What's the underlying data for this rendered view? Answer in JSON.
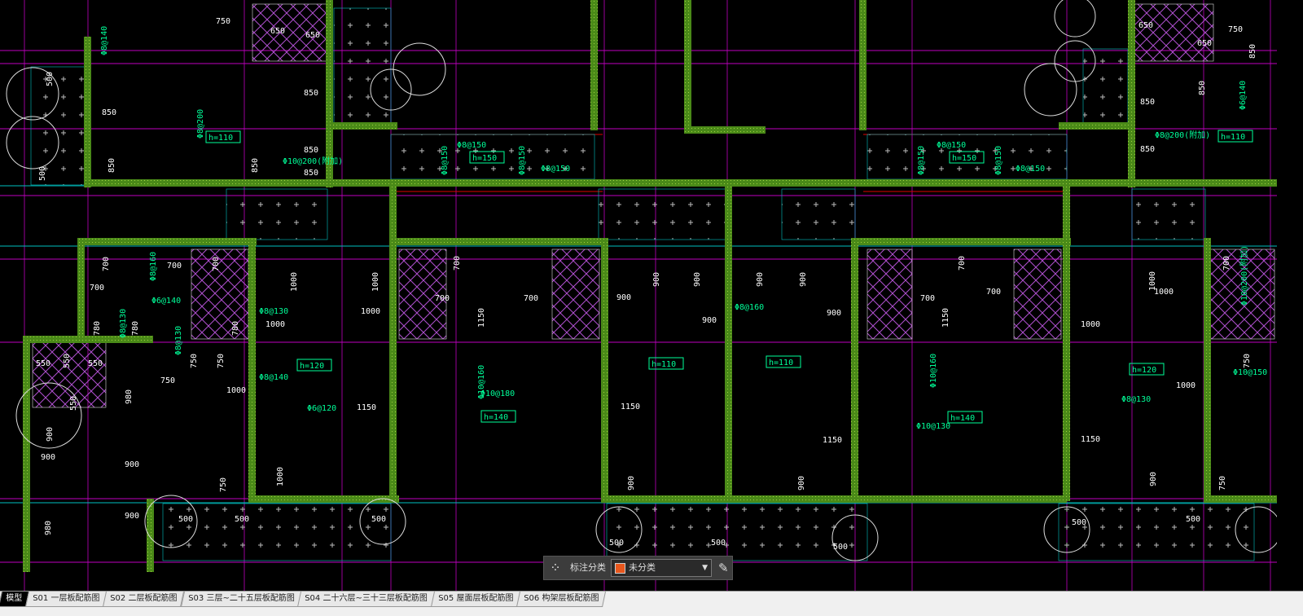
{
  "drawing": {
    "dimensions": [
      "750",
      "650",
      "650",
      "850",
      "850",
      "850",
      "850",
      "850",
      "850",
      "500",
      "500",
      "700",
      "700",
      "700",
      "700",
      "1000",
      "1000",
      "1000",
      "1000",
      "780",
      "780",
      "780",
      "750",
      "750",
      "750",
      "550",
      "550",
      "550",
      "550",
      "980",
      "1000",
      "1150",
      "900",
      "900",
      "900",
      "900",
      "980",
      "1000",
      "750",
      "500",
      "500",
      "500",
      "700",
      "700",
      "700",
      "1150",
      "900",
      "900",
      "900",
      "900",
      "900",
      "900",
      "900",
      "1150",
      "1150",
      "900",
      "900",
      "500",
      "500",
      "500",
      "700",
      "700",
      "700",
      "1150",
      "1000",
      "1000",
      "1000",
      "1000",
      "1150",
      "900",
      "750",
      "750",
      "700",
      "850",
      "850",
      "850",
      "650",
      "650",
      "750",
      "850",
      "500",
      "500"
    ],
    "rebar_labels": [
      "Φ8@140",
      "Φ8@200",
      "Φ10@200(附加)",
      "Φ8@150",
      "Φ8@150",
      "Φ8@150",
      "Φ8@150",
      "Φ8@160",
      "Φ6@140",
      "Φ8@130",
      "Φ8@130",
      "Φ8@130",
      "Φ8@140",
      "Φ6@120",
      "Φ10@160",
      "Φ10@180",
      "Φ8@160",
      "Φ10@160",
      "Φ10@130",
      "Φ8@150",
      "Φ8@150",
      "Φ8@150",
      "Φ8@150",
      "Φ8@200(附加)",
      "Φ6@140",
      "Φ10@200(附加)",
      "Φ10@150",
      "Φ8@130"
    ],
    "slab_thickness": [
      "h=110",
      "h=150",
      "h=120",
      "h=140",
      "h=110",
      "h=110",
      "h=150",
      "h=140",
      "h=120",
      "h=110"
    ]
  },
  "annotation_bar": {
    "label": "标注分类",
    "selected": "未分类",
    "selected_color": "#e8571d"
  },
  "layout_tabs": [
    "模型",
    "S01 一层板配筋图",
    "S02 二层板配筋图",
    "S03 三层~二十五层板配筋图",
    "S04 二十六层~三十三层板配筋图",
    "S05 屋面层板配筋图",
    "S06 构架层板配筋图"
  ],
  "colors": {
    "wall": "#5a9a1a",
    "rebar": "#c000c0",
    "text_rebar": "#00ff99",
    "dim": "#ffffff",
    "axis": "#00c0c0"
  }
}
